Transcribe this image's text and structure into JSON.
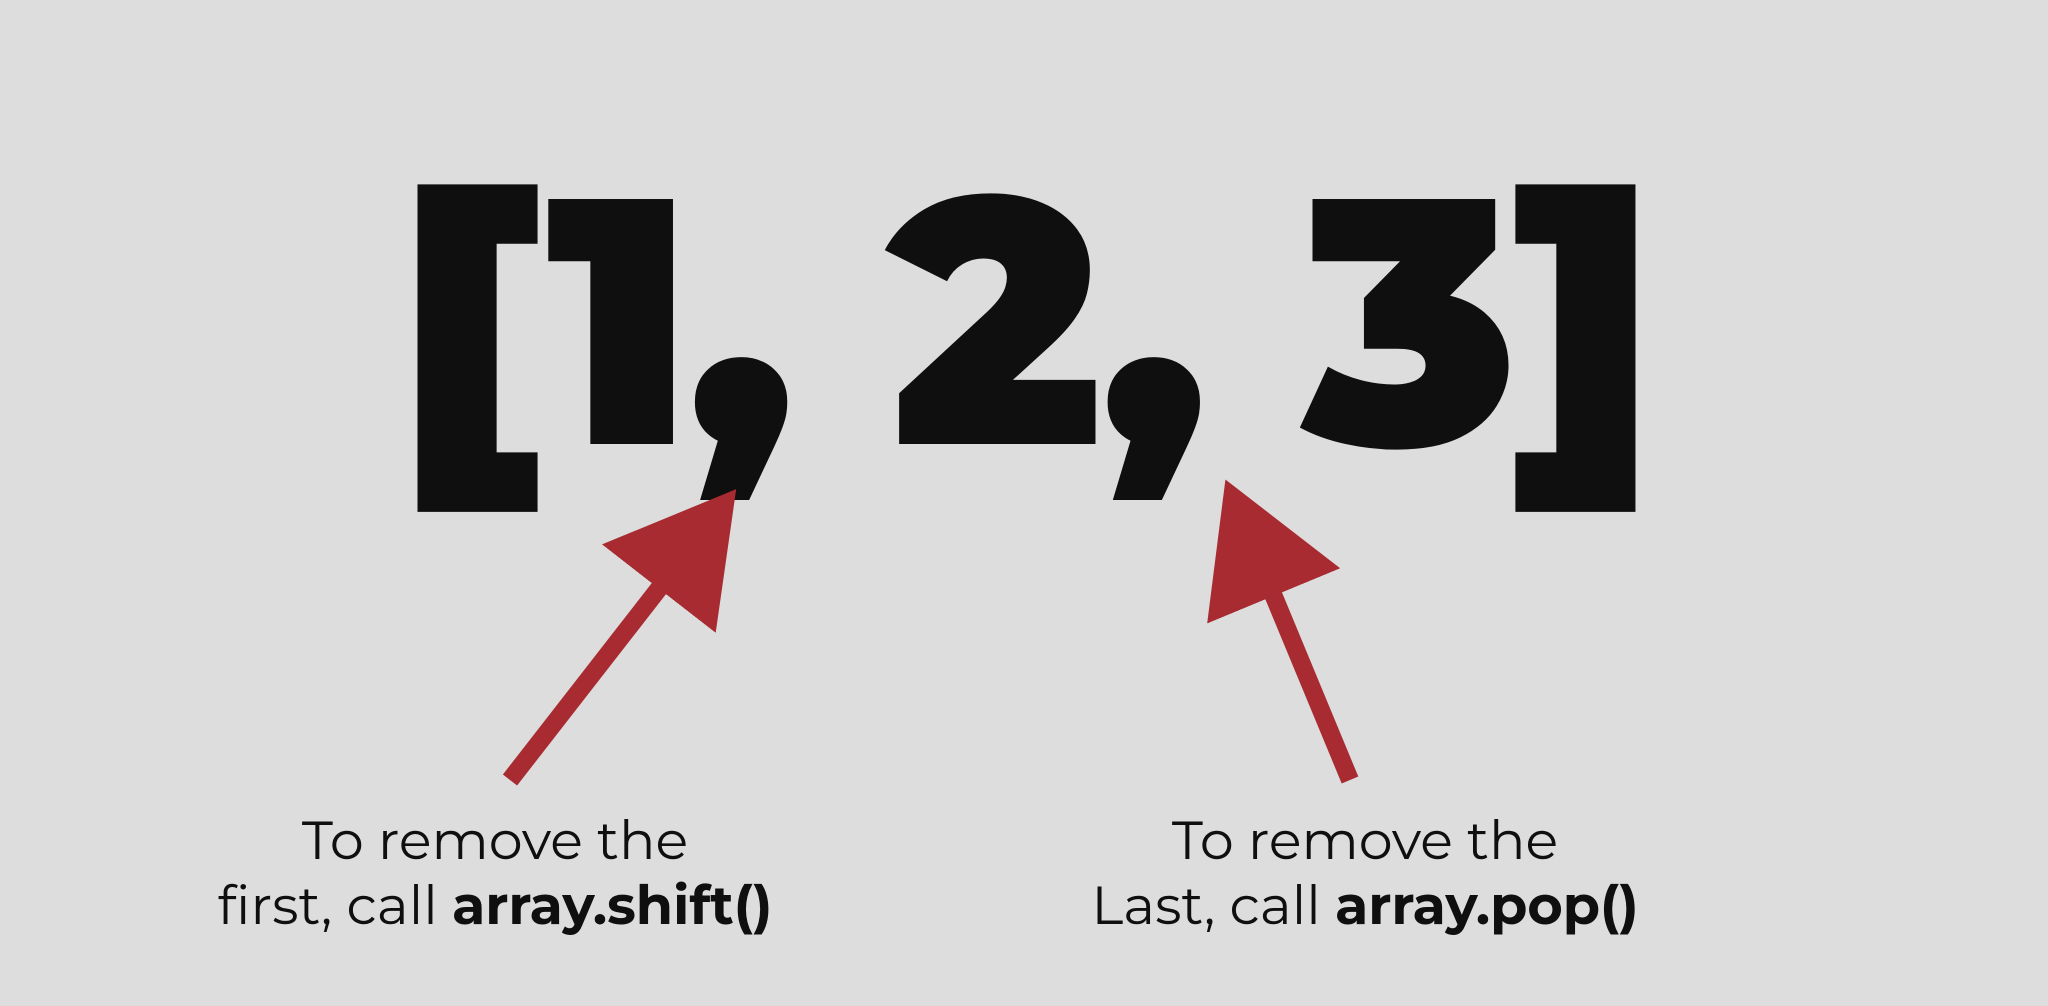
{
  "array_text": "[1, 2, 3]",
  "arrow_color": "#a72b31",
  "captions": {
    "left": {
      "line1": "To remove the",
      "line2_plain": "first, call ",
      "line2_bold": "array.shift()"
    },
    "right": {
      "line1": "To remove the",
      "line2_plain": "Last, call ",
      "line2_bold": "array.pop()"
    }
  }
}
